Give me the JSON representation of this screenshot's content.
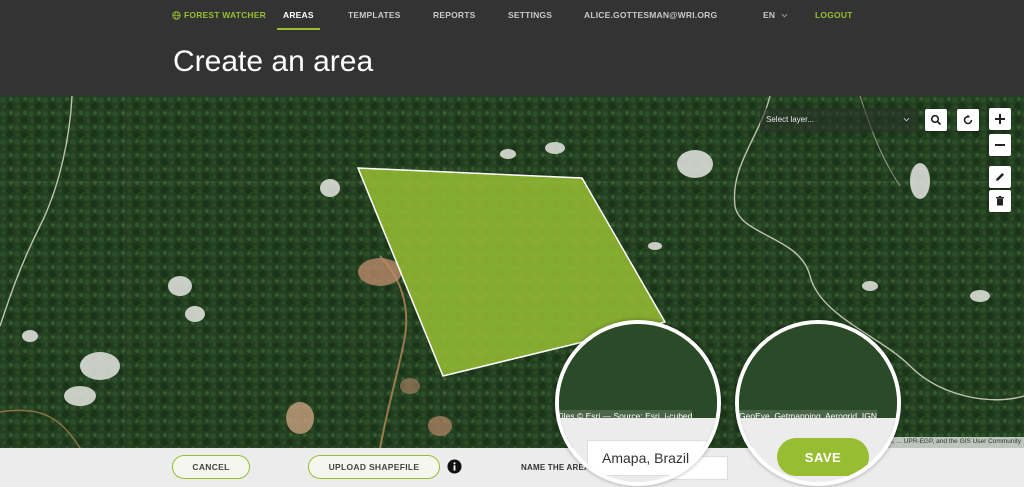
{
  "header": {
    "brand": "FOREST WATCHER",
    "nav": {
      "areas": "AREAS",
      "templates": "TEMPLATES",
      "reports": "REPORTS",
      "settings": "SETTINGS",
      "user": "ALICE.GOTTESMAN@WRI.ORG",
      "language": "EN",
      "logout": "LOGOUT"
    },
    "page_title": "Create an area"
  },
  "map": {
    "layer_select_placeholder": "Select layer...",
    "controls": [
      "search-icon",
      "refresh-icon",
      "zoom-in-icon",
      "zoom-out-icon",
      "pencil-icon",
      "trash-icon"
    ],
    "attribution": "A, USGS, ... UPR-EGP, and the GIS User Community",
    "attribution_left_zoomed": "Tiles © Esri — Source: Esri, i-cubed",
    "attribution_right_zoomed": "GeoEye, Getmapping, Aerogrid, IGN"
  },
  "footer": {
    "cancel_label": "CANCEL",
    "upload_label": "UPLOAD SHAPEFILE",
    "name_label": "NAME THE AREA",
    "name_value": "Amapa, Brazil",
    "save_label": "SAVE"
  },
  "colors": {
    "accent": "#97be32",
    "header_bg": "#333333",
    "polygon_fill": "#97be32"
  }
}
